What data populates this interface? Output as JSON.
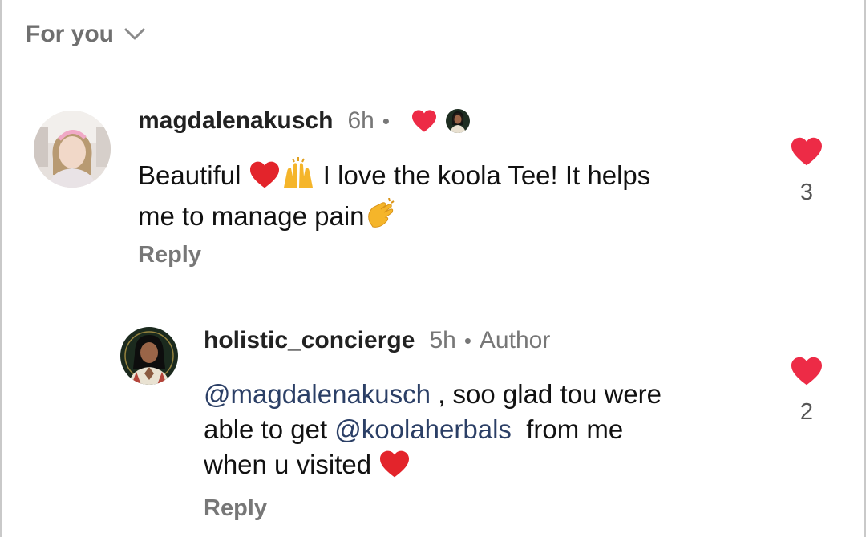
{
  "sort": {
    "label": "For you"
  },
  "comments": [
    {
      "username": "magdalenakusch",
      "time": "6h",
      "dot": "•",
      "text_line1_a": "Beautiful",
      "text_line1_b": "I love the koola Tee! It helps",
      "text_line2": "me to manage pain",
      "reply_label": "Reply",
      "like_count": "3",
      "liked_by_author": true
    },
    {
      "username": "holistic_concierge",
      "time": "5h",
      "dot": "•",
      "author_label": "Author",
      "mention1": "@magdalenakusch",
      "text_a": " , soo glad tou were",
      "text_b": "able to get ",
      "mention2": "@koolaherbals",
      "text_c": "  from me",
      "text_d": "when u visited",
      "reply_label": "Reply",
      "like_count": "2"
    }
  ],
  "colors": {
    "heart": "#ed2b46",
    "mention": "#2b3f66",
    "muted": "#777777"
  }
}
